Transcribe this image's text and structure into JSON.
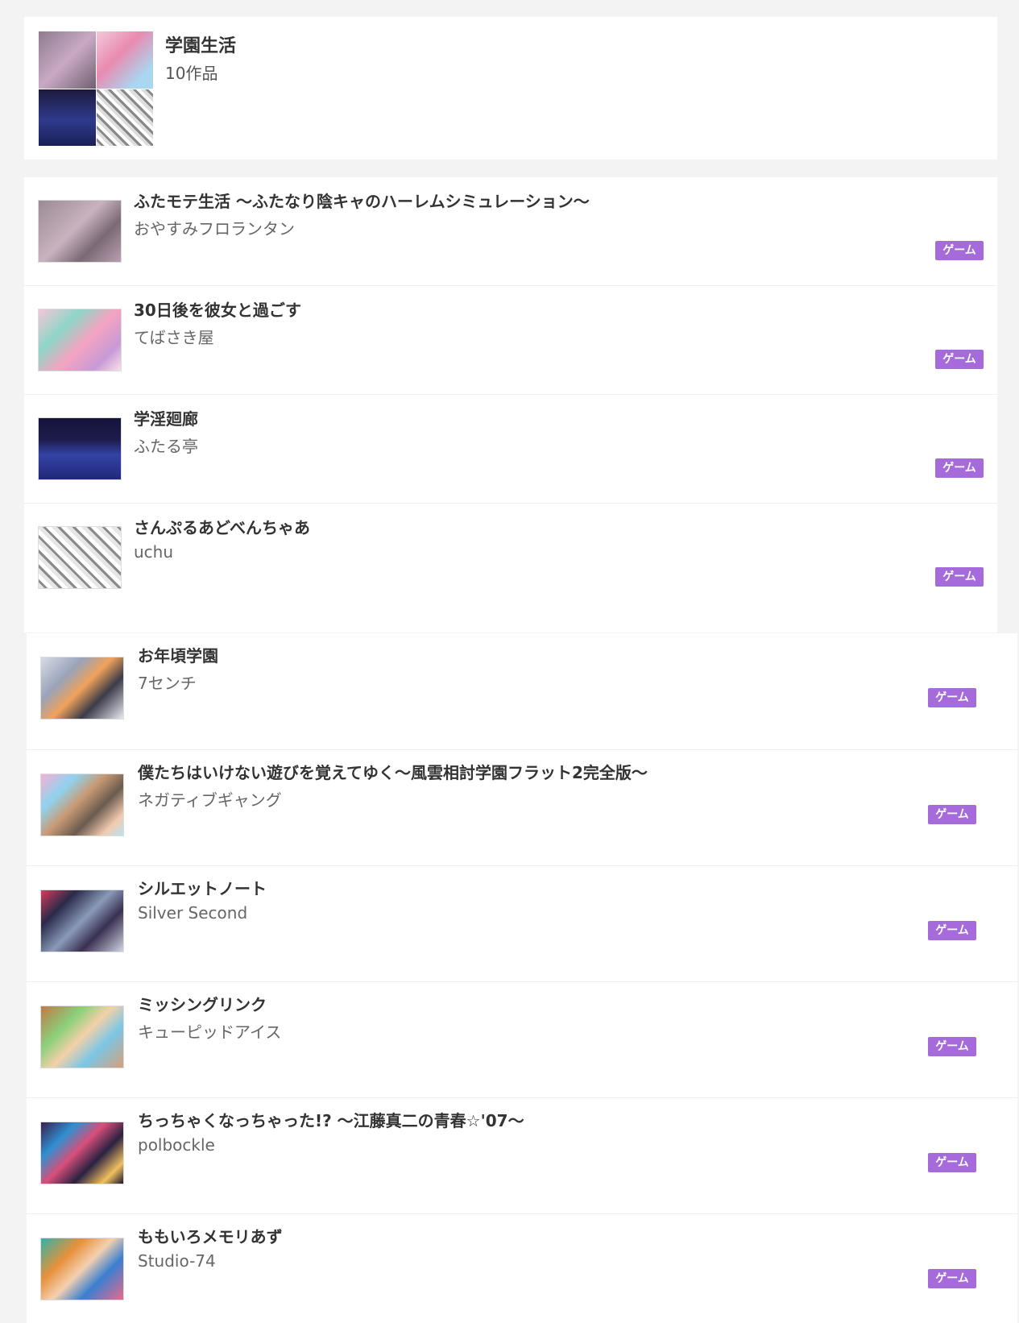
{
  "header": {
    "title": "学園生活",
    "count": "10作品"
  },
  "works": [
    {
      "title": "ふたモテ生活 〜ふたなり陰キャのハーレムシミュレーション〜",
      "circle": "おやすみフロランタン",
      "tag": "ゲーム"
    },
    {
      "title": "30日後を彼女と過ごす",
      "circle": "てばさき屋",
      "tag": "ゲーム"
    },
    {
      "title": "学淫廻廊",
      "circle": "ふたる亭",
      "tag": "ゲーム"
    },
    {
      "title": "さんぷるあどべんちゃあ",
      "circle": "uchu",
      "tag": "ゲーム"
    },
    {
      "title": "お年頃学園",
      "circle": "7センチ",
      "tag": "ゲーム"
    },
    {
      "title": "僕たちはいけない遊びを覚えてゆく〜風雲相討学園フラット2完全版〜",
      "circle": "ネガティブギャング",
      "tag": "ゲーム"
    },
    {
      "title": "シルエットノート",
      "circle": "Silver Second",
      "tag": "ゲーム"
    },
    {
      "title": "ミッシングリンク",
      "circle": "キューピッドアイス",
      "tag": "ゲーム"
    },
    {
      "title": "ちっちゃくなっちゃった!? 〜江藤真二の青春☆'07〜",
      "circle": "polbockle",
      "tag": "ゲーム"
    },
    {
      "title": "ももいろメモリあず",
      "circle": "Studio-74",
      "tag": "ゲーム"
    }
  ],
  "colors": {
    "tag_bg": "#a56bdb",
    "page_bg": "#f3f3f3"
  },
  "icons": {
    "video": "play-video-icon"
  }
}
